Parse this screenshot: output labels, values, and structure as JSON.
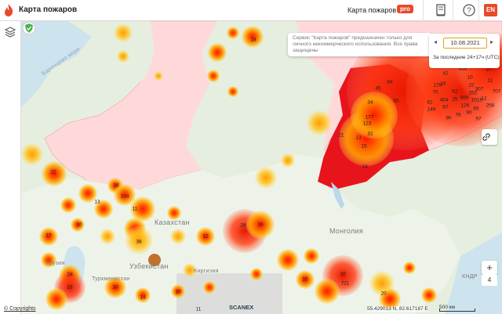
{
  "header": {
    "app_title": "Карта пожаров",
    "pro_link": "Карта пожаров",
    "pro_badge": "pro",
    "lang_button": "EN",
    "icons": [
      "logo-flame-icon",
      "book-icon",
      "help-icon"
    ]
  },
  "sidebar": {
    "layers_icon": "layers-icon",
    "copyright": "© Copyrights"
  },
  "notice": "Сервис \"Карта пожаров\" предназначен только для личного некоммерческого использования. Все права защищены",
  "date_panel": {
    "prev": "◂",
    "date": "10.08.2021",
    "next": "▸",
    "range": "За последние 24+17ч (UTC)"
  },
  "map": {
    "labels": {
      "kazakhstan": "Казахстан",
      "mongolia": "Монголия",
      "uzbekistan": "Узбекистан",
      "kyrgyzstan": "Киргизия",
      "turkmenistan": "Туркменистан",
      "georgia": "Грузия",
      "kndr": "КНДР",
      "barents": "Баренцево море"
    },
    "fire_counts": [
      "18",
      "64",
      "45",
      "34",
      "85",
      "177",
      "123",
      "13",
      "32",
      "21",
      "14",
      "15",
      "22",
      "16",
      "104",
      "13",
      "38",
      "11",
      "10",
      "17",
      "28",
      "23",
      "14",
      "28",
      "16",
      "721",
      "16",
      "20",
      "10",
      "12",
      "42",
      "616",
      "18",
      "10",
      "27",
      "62",
      "22",
      "11",
      "178",
      "70",
      "404",
      "25",
      "886",
      "252",
      "307",
      "126",
      "12",
      "1019",
      "256",
      "78",
      "62",
      "149",
      "67",
      "90",
      "90",
      "65",
      "707",
      "97",
      "11",
      "10",
      "15"
    ]
  },
  "controls": {
    "link_icon": "link-icon",
    "zoom_in": "+",
    "zoom_level": "4",
    "zoom_out": "−",
    "shield_icon": "shield-icon"
  },
  "footer": {
    "scanex": "SCANEX",
    "coords": "55.429013 N, 82.617187 E",
    "scale": "500 км"
  },
  "colors": {
    "accent": "#e8492a",
    "fire_core": "#ff2a00",
    "fire_mid": "#ff7a00",
    "fire_outer": "#ffc21a",
    "russia_fill": "#ffd6d6",
    "region_red": "#e8141c"
  }
}
